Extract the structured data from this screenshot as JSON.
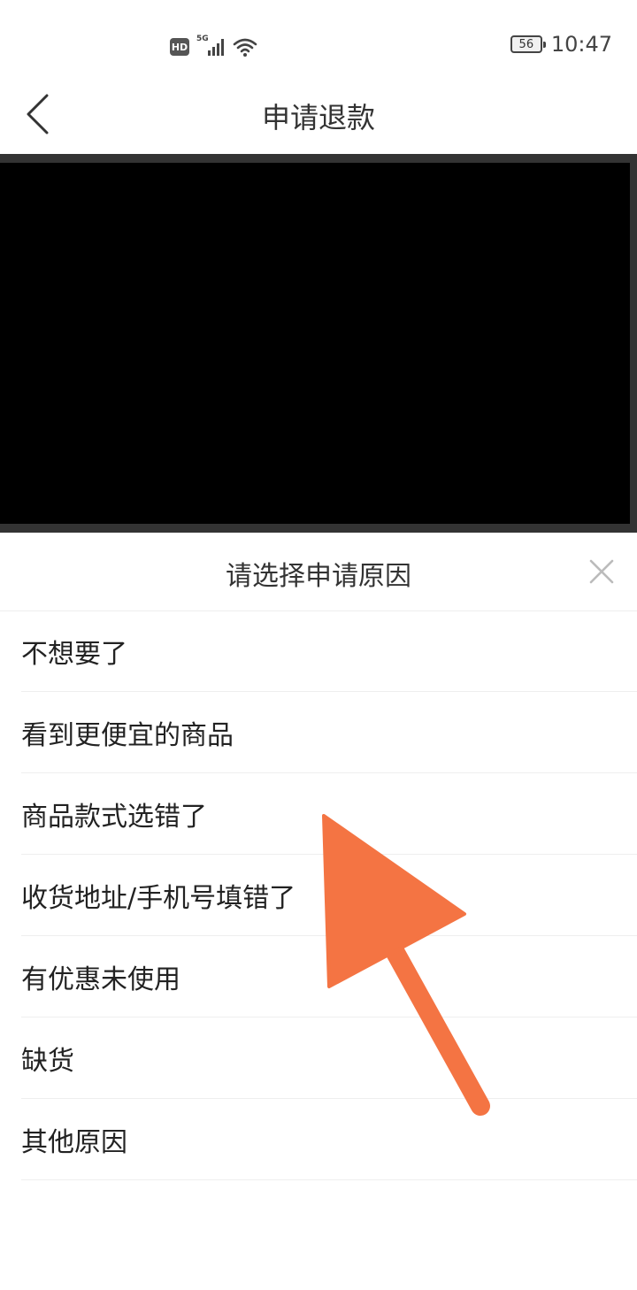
{
  "status_bar": {
    "hd_label": "HD",
    "network_label": "5G",
    "battery_level": "56",
    "time": "10:47"
  },
  "header": {
    "title": "申请退款",
    "back_icon": "chevron-left-icon"
  },
  "sheet": {
    "title": "请选择申请原因",
    "close_icon": "close-icon",
    "reasons": [
      {
        "label": "不想要了"
      },
      {
        "label": "看到更便宜的商品"
      },
      {
        "label": "商品款式选错了"
      },
      {
        "label": "收货地址/手机号填错了"
      },
      {
        "label": "有优惠未使用"
      },
      {
        "label": "缺货"
      },
      {
        "label": "其他原因"
      }
    ]
  },
  "annotation": {
    "arrow_color": "#f47443"
  }
}
